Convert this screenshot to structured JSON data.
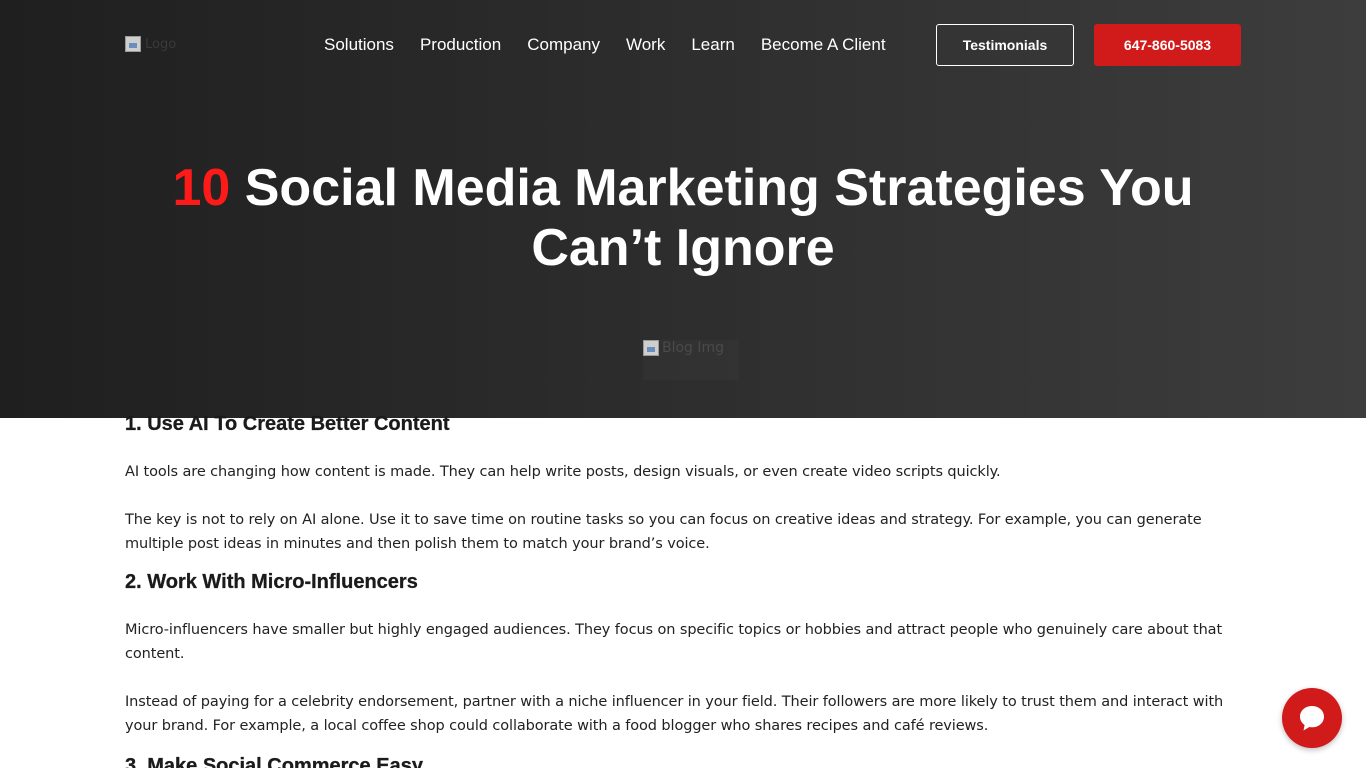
{
  "header": {
    "logo_alt": "Logo",
    "nav": [
      "Solutions",
      "Production",
      "Company",
      "Work",
      "Learn",
      "Become A Client"
    ],
    "testimonials_label": "Testimonials",
    "phone_label": "647-860-5083",
    "accent_color": "#d11a1a"
  },
  "hero": {
    "title_number": "10",
    "title_text": "Social Media Marketing Strategies You Can’t Ignore",
    "image_alt": "Blog Img"
  },
  "article": {
    "sections": [
      {
        "heading": "1. Use AI To Create Better Content",
        "paragraphs": [
          "AI tools are changing how content is made. They can help write posts, design visuals, or even create video scripts quickly.",
          "The key is not to rely on AI alone. Use it to save time on routine tasks so you can focus on creative ideas and strategy. For example, you can generate multiple post ideas in minutes and then polish them to match your brand’s voice."
        ]
      },
      {
        "heading": "2. Work With Micro-Influencers",
        "paragraphs": [
          "Micro-influencers have smaller but highly engaged audiences. They focus on specific topics or hobbies and attract people who genuinely care about that content.",
          "Instead of paying for a celebrity endorsement, partner with a niche influencer in your field. Their followers are more likely to trust them and interact with your brand. For example, a local coffee shop could collaborate with a food blogger who shares recipes and café reviews."
        ]
      },
      {
        "heading": "3. Make Social Commerce Easy",
        "paragraphs": []
      }
    ]
  },
  "chat": {
    "icon": "chat-bubble-icon"
  }
}
